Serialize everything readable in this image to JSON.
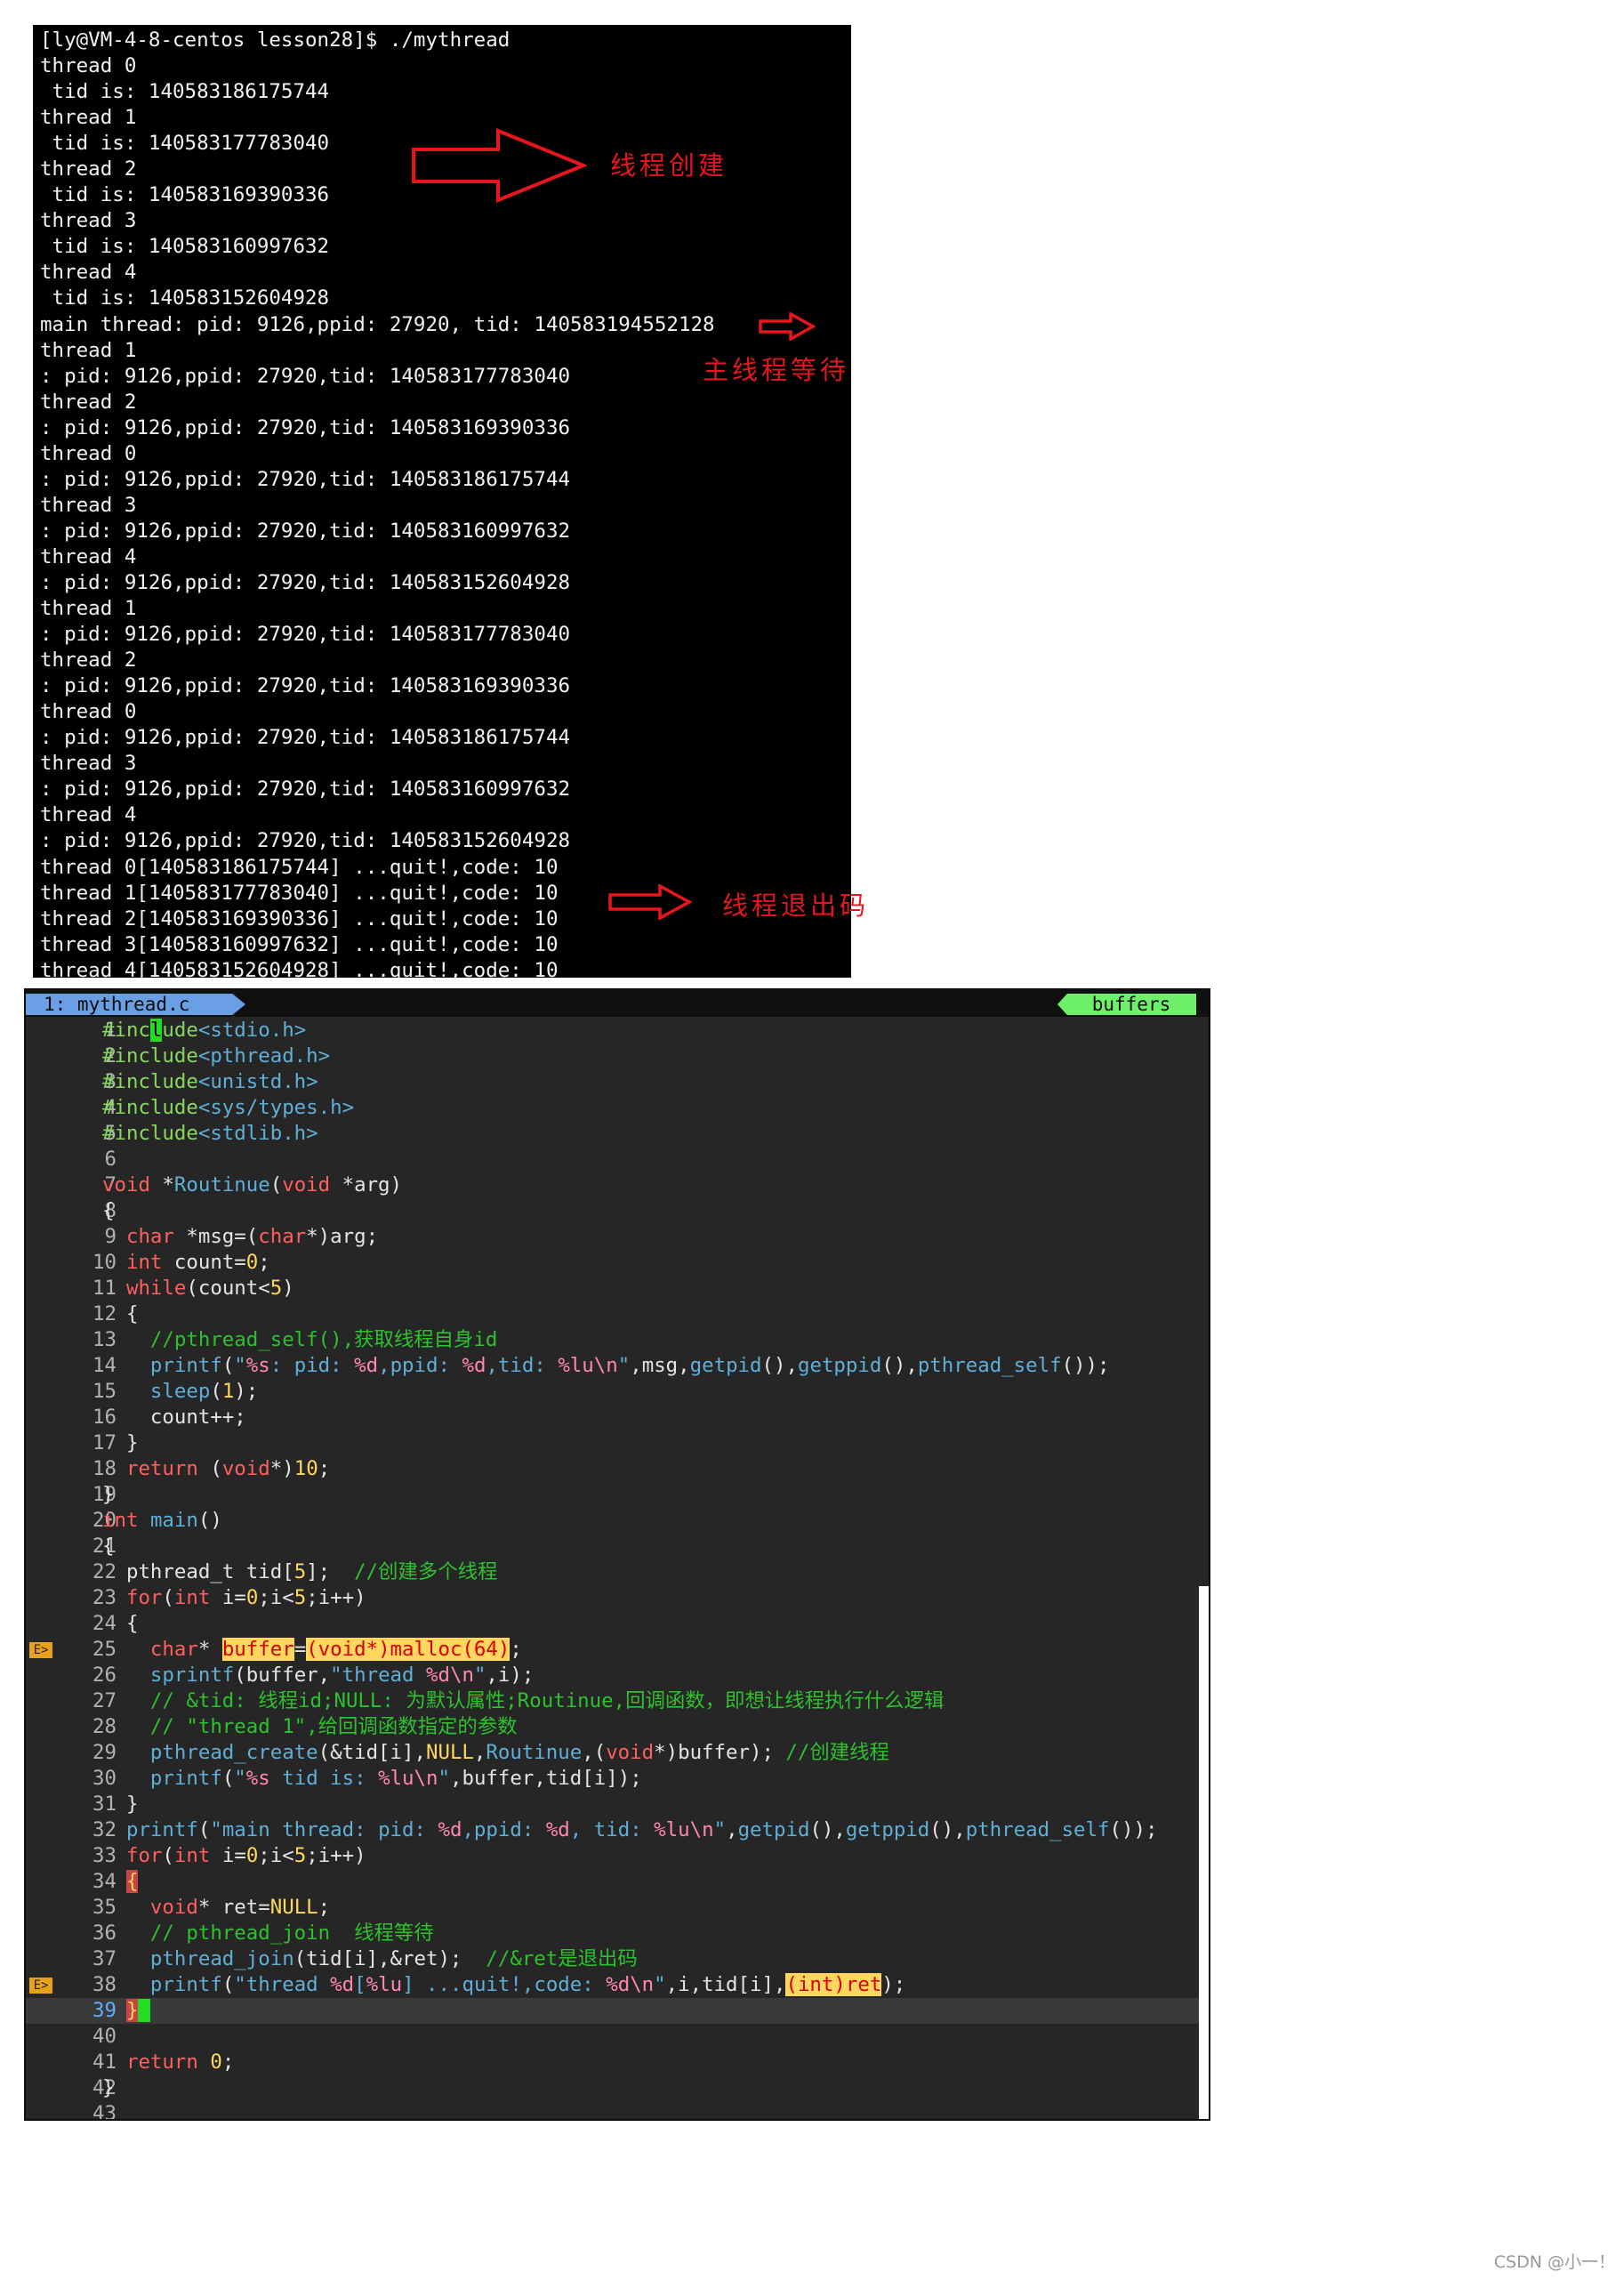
{
  "terminal": {
    "lines": [
      "[ly@VM-4-8-centos lesson28]$ ./mythread",
      "thread 0",
      " tid is: 140583186175744",
      "thread 1",
      " tid is: 140583177783040",
      "thread 2",
      " tid is: 140583169390336",
      "thread 3",
      " tid is: 140583160997632",
      "thread 4",
      " tid is: 140583152604928",
      "main thread: pid: 9126,ppid: 27920, tid: 140583194552128",
      "thread 1",
      ": pid: 9126,ppid: 27920,tid: 140583177783040",
      "thread 2",
      ": pid: 9126,ppid: 27920,tid: 140583169390336",
      "thread 0",
      ": pid: 9126,ppid: 27920,tid: 140583186175744",
      "thread 3",
      ": pid: 9126,ppid: 27920,tid: 140583160997632",
      "thread 4",
      ": pid: 9126,ppid: 27920,tid: 140583152604928",
      "thread 1",
      ": pid: 9126,ppid: 27920,tid: 140583177783040",
      "thread 2",
      ": pid: 9126,ppid: 27920,tid: 140583169390336",
      "thread 0",
      ": pid: 9126,ppid: 27920,tid: 140583186175744",
      "thread 3",
      ": pid: 9126,ppid: 27920,tid: 140583160997632",
      "thread 4",
      ": pid: 9126,ppid: 27920,tid: 140583152604928",
      "thread 0[140583186175744] ...quit!,code: 10",
      "thread 1[140583177783040] ...quit!,code: 10",
      "thread 2[140583169390336] ...quit!,code: 10",
      "thread 3[140583160997632] ...quit!,code: 10",
      "thread 4[140583152604928] ...quit!,code: 10"
    ]
  },
  "annotations": {
    "create": "线程创建",
    "main_wait": "主线程等待",
    "exit_code": "线程退出码",
    "color": "#e8161c"
  },
  "editor": {
    "tab_label": "1: mythread.c",
    "buffers_label": "buffers",
    "colors": {
      "background": "#262626",
      "keyword": "#ff5f5f",
      "preproc": "#87d75f",
      "function": "#5fafd7",
      "number": "#ffd75f",
      "comment": "#2ec12e",
      "error_sign": "#e8a21a"
    },
    "lines": [
      {
        "n": "1",
        "code": "#include<stdio.h>"
      },
      {
        "n": "2",
        "code": "#include<pthread.h>"
      },
      {
        "n": "3",
        "code": "#include<unistd.h>"
      },
      {
        "n": "4",
        "code": "#include<sys/types.h>"
      },
      {
        "n": "5",
        "code": "#include<stdlib.h>"
      },
      {
        "n": "6",
        "code": ""
      },
      {
        "n": "7",
        "code": "void *Routinue(void *arg)"
      },
      {
        "n": "8",
        "code": "{"
      },
      {
        "n": "9",
        "code": "  char *msg=(char*)arg;"
      },
      {
        "n": "10",
        "code": "  int count=0;"
      },
      {
        "n": "11",
        "code": "  while(count<5)"
      },
      {
        "n": "12",
        "code": "  {"
      },
      {
        "n": "13",
        "code": "    //pthread_self(),获取线程自身id"
      },
      {
        "n": "14",
        "code": "    printf(\"%s: pid: %d,ppid: %d,tid: %lu\\n\",msg,getpid(),getppid(),pthread_self());"
      },
      {
        "n": "15",
        "code": "    sleep(1);"
      },
      {
        "n": "16",
        "code": "    count++;"
      },
      {
        "n": "17",
        "code": "  }"
      },
      {
        "n": "18",
        "code": "  return (void*)10;"
      },
      {
        "n": "19",
        "code": "}"
      },
      {
        "n": "20",
        "code": "int main()"
      },
      {
        "n": "21",
        "code": "{"
      },
      {
        "n": "22",
        "code": "  pthread_t tid[5];  //创建多个线程"
      },
      {
        "n": "23",
        "code": "  for(int i=0;i<5;i++)"
      },
      {
        "n": "24",
        "code": "  {"
      },
      {
        "n": "25",
        "code": "    char* buffer=(void*)malloc(64);",
        "sign": "E>"
      },
      {
        "n": "26",
        "code": "    sprintf(buffer,\"thread %d\\n\",i);"
      },
      {
        "n": "27",
        "code": "    // &tid: 线程id;NULL: 为默认属性;Routinue,回调函数，即想让线程执行什么逻辑"
      },
      {
        "n": "28",
        "code": "    // \"thread 1\",给回调函数指定的参数"
      },
      {
        "n": "29",
        "code": "    pthread_create(&tid[i],NULL,Routinue,(void*)buffer); //创建线程"
      },
      {
        "n": "30",
        "code": "    printf(\"%s tid is: %lu\\n\",buffer,tid[i]);"
      },
      {
        "n": "31",
        "code": "  }"
      },
      {
        "n": "32",
        "code": "  printf(\"main thread: pid: %d,ppid: %d, tid: %lu\\n\",getpid(),getppid(),pthread_self());"
      },
      {
        "n": "33",
        "code": "  for(int i=0;i<5;i++)"
      },
      {
        "n": "34",
        "code": "  {"
      },
      {
        "n": "35",
        "code": "    void* ret=NULL;"
      },
      {
        "n": "36",
        "code": "    // pthread_join  线程等待"
      },
      {
        "n": "37",
        "code": "    pthread_join(tid[i],&ret);  //&ret是退出码"
      },
      {
        "n": "38",
        "code": "    printf(\"thread %d[%lu] ...quit!,code: %d\\n\",i,tid[i],(int)ret);",
        "sign": "E>"
      },
      {
        "n": "39",
        "code": "  }"
      },
      {
        "n": "40",
        "code": ""
      },
      {
        "n": "41",
        "code": "  return 0;"
      },
      {
        "n": "42",
        "code": "}"
      },
      {
        "n": "43",
        "code": ""
      }
    ]
  },
  "watermark": "CSDN @小一！"
}
